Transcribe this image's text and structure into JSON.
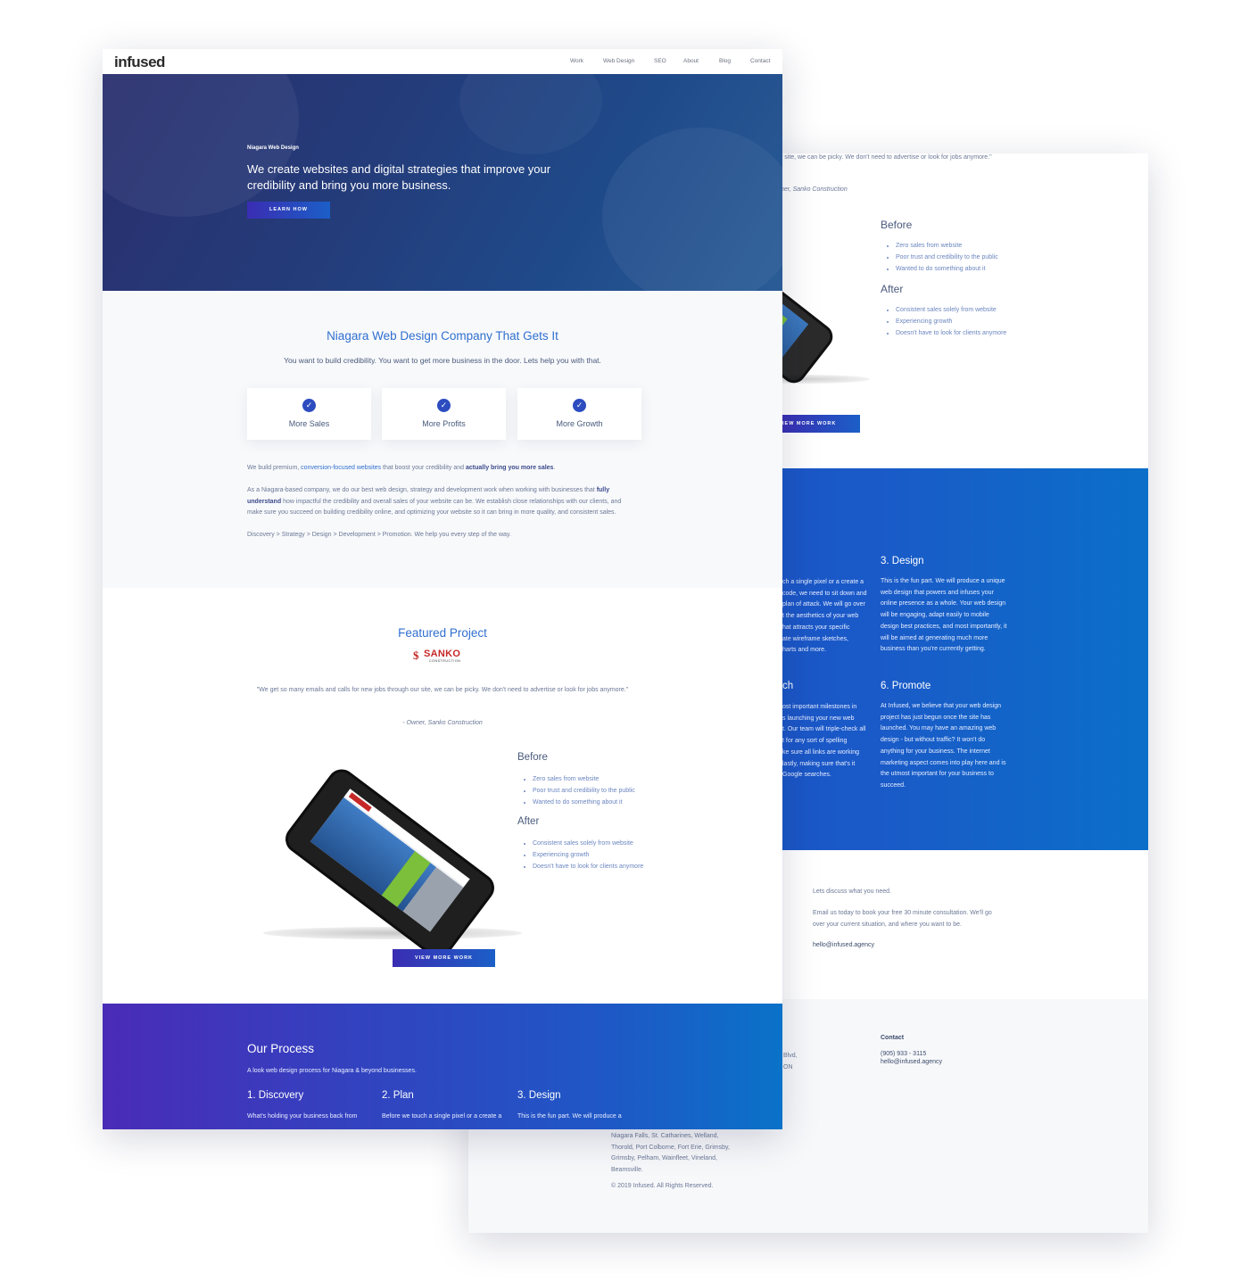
{
  "back": {
    "quote_fragment": "r site, we can be picky. We don't need to advertise or look for jobs anymore.\"",
    "owner_fragment": "ner, Sanko Construction",
    "before_title": "Before",
    "before_items": [
      "Zero sales from website",
      "Poor trust and credibility to the public",
      "Wanted to do something about it"
    ],
    "after_title": "After",
    "after_items": [
      "Consistent sales solely from website",
      "Experiencing growth",
      "Doesn't have to look for clients anymore"
    ],
    "view_more_fragment": "IEW MORE WORK",
    "plan_fragment_lines": [
      "ch a single pixel or a create a",
      "code, we need to sit down and",
      "plan of attack. We will go over",
      "t the aesthetics of your web",
      "hat attracts your specific",
      "ate wireframe sketches,",
      "harts and more."
    ],
    "design_title": "3. Design",
    "design_text": "This is the fun part. We will produce a unique web design that powers and infuses your online presence as a whole. Your web design will be engaging, adapt easily to mobile design best practices, and most importantly, it will be aimed at generating much more business than you're currently getting.",
    "launch_fragment_title": "ch",
    "launch_fragment_lines": [
      "ost important milestones in",
      "s launching your new web",
      "t. Our team will triple-check all",
      "t for any sort of spelling",
      "ke sure all links are working",
      "lastly, making sure that's it",
      "Google searches."
    ],
    "promote_title": "6. Promote",
    "promote_text": "At Infused, we believe that your web design project has just begun once the site has launched. You may have an amazing web design - but without traffic? It won't do anything for your business. The internet marketing aspect comes into play here and is the utmost important for your business to succeed.",
    "contact_lead": "Lets discuss what you need.",
    "contact_text": "Email us today to book your free 30 minute consultation. We'll go over your current situation, and where you want to be.",
    "contact_email": "hello@infused.agency",
    "footer_addr_lines": [
      "Blvd,",
      "ON"
    ],
    "footer_contact_title": "Contact",
    "footer_phone": "(905) 933 - 3115",
    "footer_email": "hello@infused.agency",
    "footer_cities_lines": [
      "Niagara Falls, St. Catharines, Welland,",
      "Thorold, Port Colborne, Fort Erie, Grimsby,",
      "Grimsby, Pelham, Wainfleet, Vineland,",
      "Beamsville."
    ],
    "copyright": "© 2019 Infused. All Rights Reserved."
  },
  "front": {
    "logo": "infused",
    "nav": [
      "Work",
      "Web Design",
      "SEO",
      "About",
      "Blog",
      "Contact"
    ],
    "hero": {
      "eyebrow": "Niagara Web Design",
      "headline_line1": "We create websites and digital strategies that improve your",
      "headline_line2": "credibility and bring you more business.",
      "button": "LEARN HOW"
    },
    "intro": {
      "title": "Niagara Web Design Company That Gets It",
      "subtitle": "You want to build credibility. You want to get more business in the door. Lets help you with that.",
      "features": [
        "More Sales",
        "More Profits",
        "More Growth"
      ],
      "p1_a": "We build premium, ",
      "p1_link": "conversion-focused websites",
      "p1_b": " that boost your credibility and ",
      "p1_bold": "actually bring you more sales",
      "p1_c": ".",
      "p2_line1_a": "As a Niagara-based company, we do our best web design, strategy and development work when working with businesses that ",
      "p2_bold1": "fully",
      "p2_bold2": "understand",
      "p2_line2": " how impactful the credibility and overall sales of your website can be. We establish close relationships with our clients, and",
      "p2_line3": "make sure you succeed on building credibility online, and optimizing your website so it can bring in more quality, and consistent sales.",
      "p3": "Discovery > Strategy > Design > Development > Promotion. We help you every step of the way."
    },
    "featured": {
      "title": "Featured Project",
      "client_logo": "SANKO",
      "client_logo_sub": "CONSTRUCTION",
      "quote": "\"We get so many emails and calls for new jobs through our site, we can be picky. We don't need to advertise or look for jobs anymore.\"",
      "attribution_prefix": "- Owner, ",
      "attribution_company": "Sanko Construction",
      "before_title": "Before",
      "before_items": [
        "Zero sales from website",
        "Poor trust and credibility to the public",
        "Wanted to do something about it"
      ],
      "after_title": "After",
      "after_items": [
        "Consistent sales solely from website",
        "Experiencing growth",
        "Doesn't have to look for clients anymore"
      ],
      "button": "VIEW MORE WORK"
    },
    "process": {
      "title": "Our Process",
      "subtitle": "A look web design process for Niagara & beyond businesses.",
      "steps": [
        {
          "title": "1. Discovery",
          "text": "What's holding your business back from"
        },
        {
          "title": "2. Plan",
          "text": "Before we touch a single pixel or a create a"
        },
        {
          "title": "3. Design",
          "text": "This is the fun part. We will produce a"
        }
      ]
    }
  },
  "colors": {
    "accent_blue": "#2f6fcf",
    "process_gradient_start": "#4a2bb8",
    "process_gradient_end": "#0a72c8",
    "hero_dark": "#243c7a"
  }
}
